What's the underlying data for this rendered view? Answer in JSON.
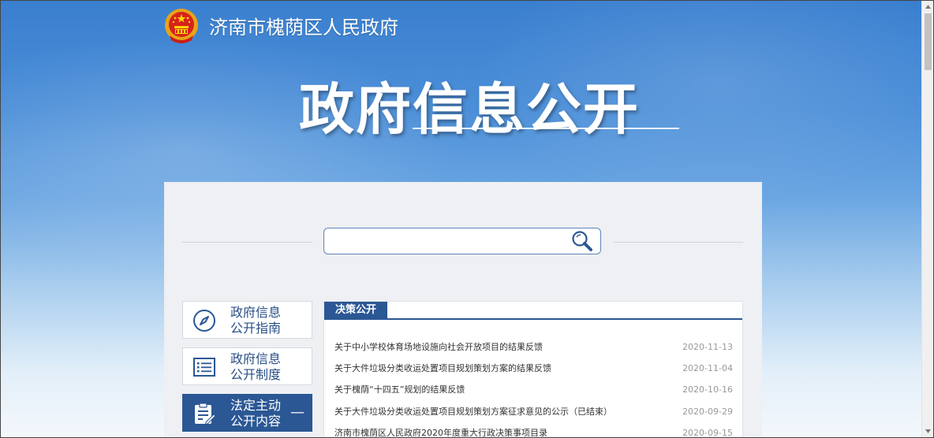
{
  "header": {
    "site_title": "济南市槐荫区人民政府",
    "hero_title": "政府信息公开"
  },
  "search": {
    "placeholder": ""
  },
  "menu": [
    {
      "label_line1": "政府信息",
      "label_line2": "公开指南",
      "icon": "compass-icon",
      "active": false
    },
    {
      "label_line1": "政府信息",
      "label_line2": "公开制度",
      "icon": "list-icon",
      "active": false
    },
    {
      "label_line1": "法定主动",
      "label_line2": "公开内容",
      "icon": "edit-document-icon",
      "active": true,
      "toggle": "—"
    }
  ],
  "news": {
    "tab_label": "决策公开",
    "items": [
      {
        "title": "关于中小学校体育场地设施向社会开放项目的结果反馈",
        "date": "2020-11-13"
      },
      {
        "title": "关于大件垃圾分类收运处置项目规划策划方案的结果反馈",
        "date": "2020-11-04"
      },
      {
        "title": "关于槐荫“十四五”规划的结果反馈",
        "date": "2020-10-16"
      },
      {
        "title": "关于大件垃圾分类收运处置项目规划策划方案征求意见的公示（已结束）",
        "date": "2020-09-29"
      },
      {
        "title": "济南市槐荫区人民政府2020年度重大行政决策事项目录",
        "date": "2020-09-15"
      }
    ]
  },
  "colors": {
    "primary": "#2b5794",
    "banner_top": "#3a7fcf"
  }
}
